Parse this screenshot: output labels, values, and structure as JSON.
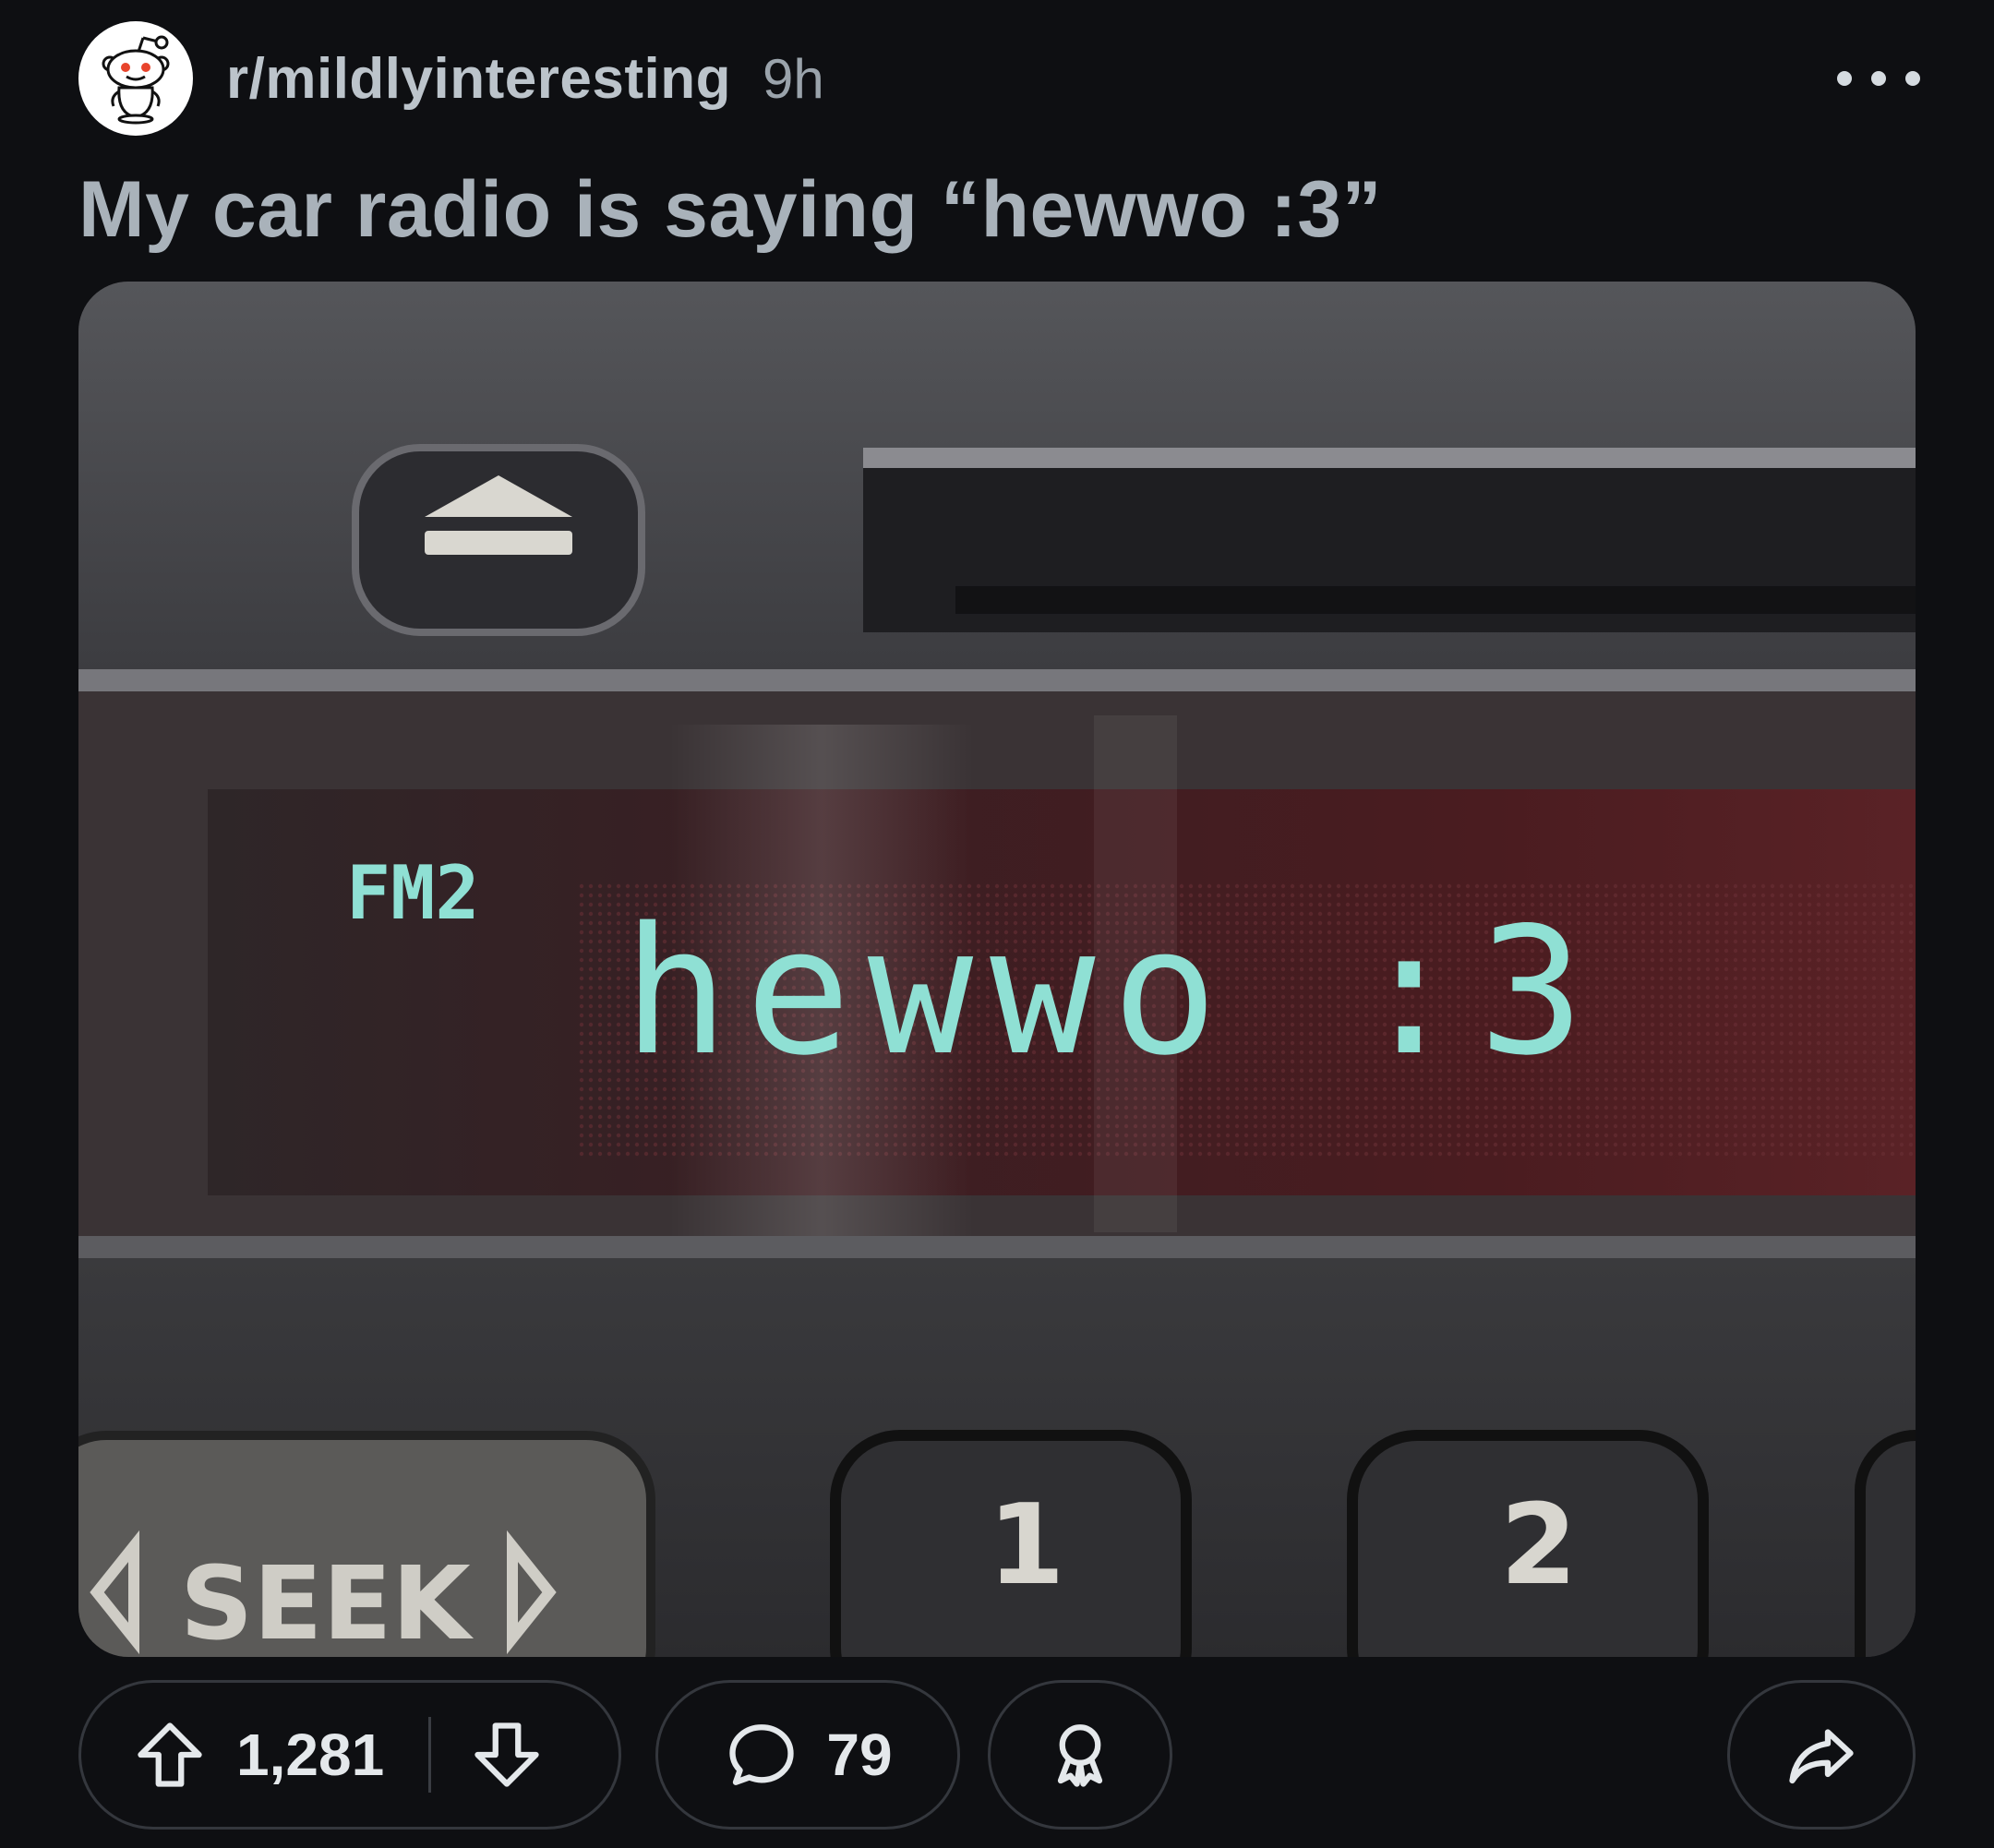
{
  "post": {
    "subreddit": "r/mildlyinteresting",
    "age": "9h",
    "title": "My car radio is saying “hewwo :3”",
    "more_icon": "more-horizontal-icon"
  },
  "image": {
    "display_band": "FM2",
    "display_text": "hewwo :3",
    "preset_1": "1",
    "preset_2": "2",
    "seek_label": "SEEK",
    "display_color": "#8fe0d4"
  },
  "actions": {
    "upvote_icon": "upvote-arrow-icon",
    "vote_count": "1,281",
    "downvote_icon": "downvote-arrow-icon",
    "comment_icon": "speech-bubble-icon",
    "comment_count": "79",
    "award_icon": "award-ribbon-icon",
    "share_icon": "share-arrow-icon"
  },
  "colors": {
    "background": "#0e0f12",
    "text_primary": "#e4e8eb",
    "text_muted": "#a9b2ba",
    "pill_border": "#34373d"
  }
}
